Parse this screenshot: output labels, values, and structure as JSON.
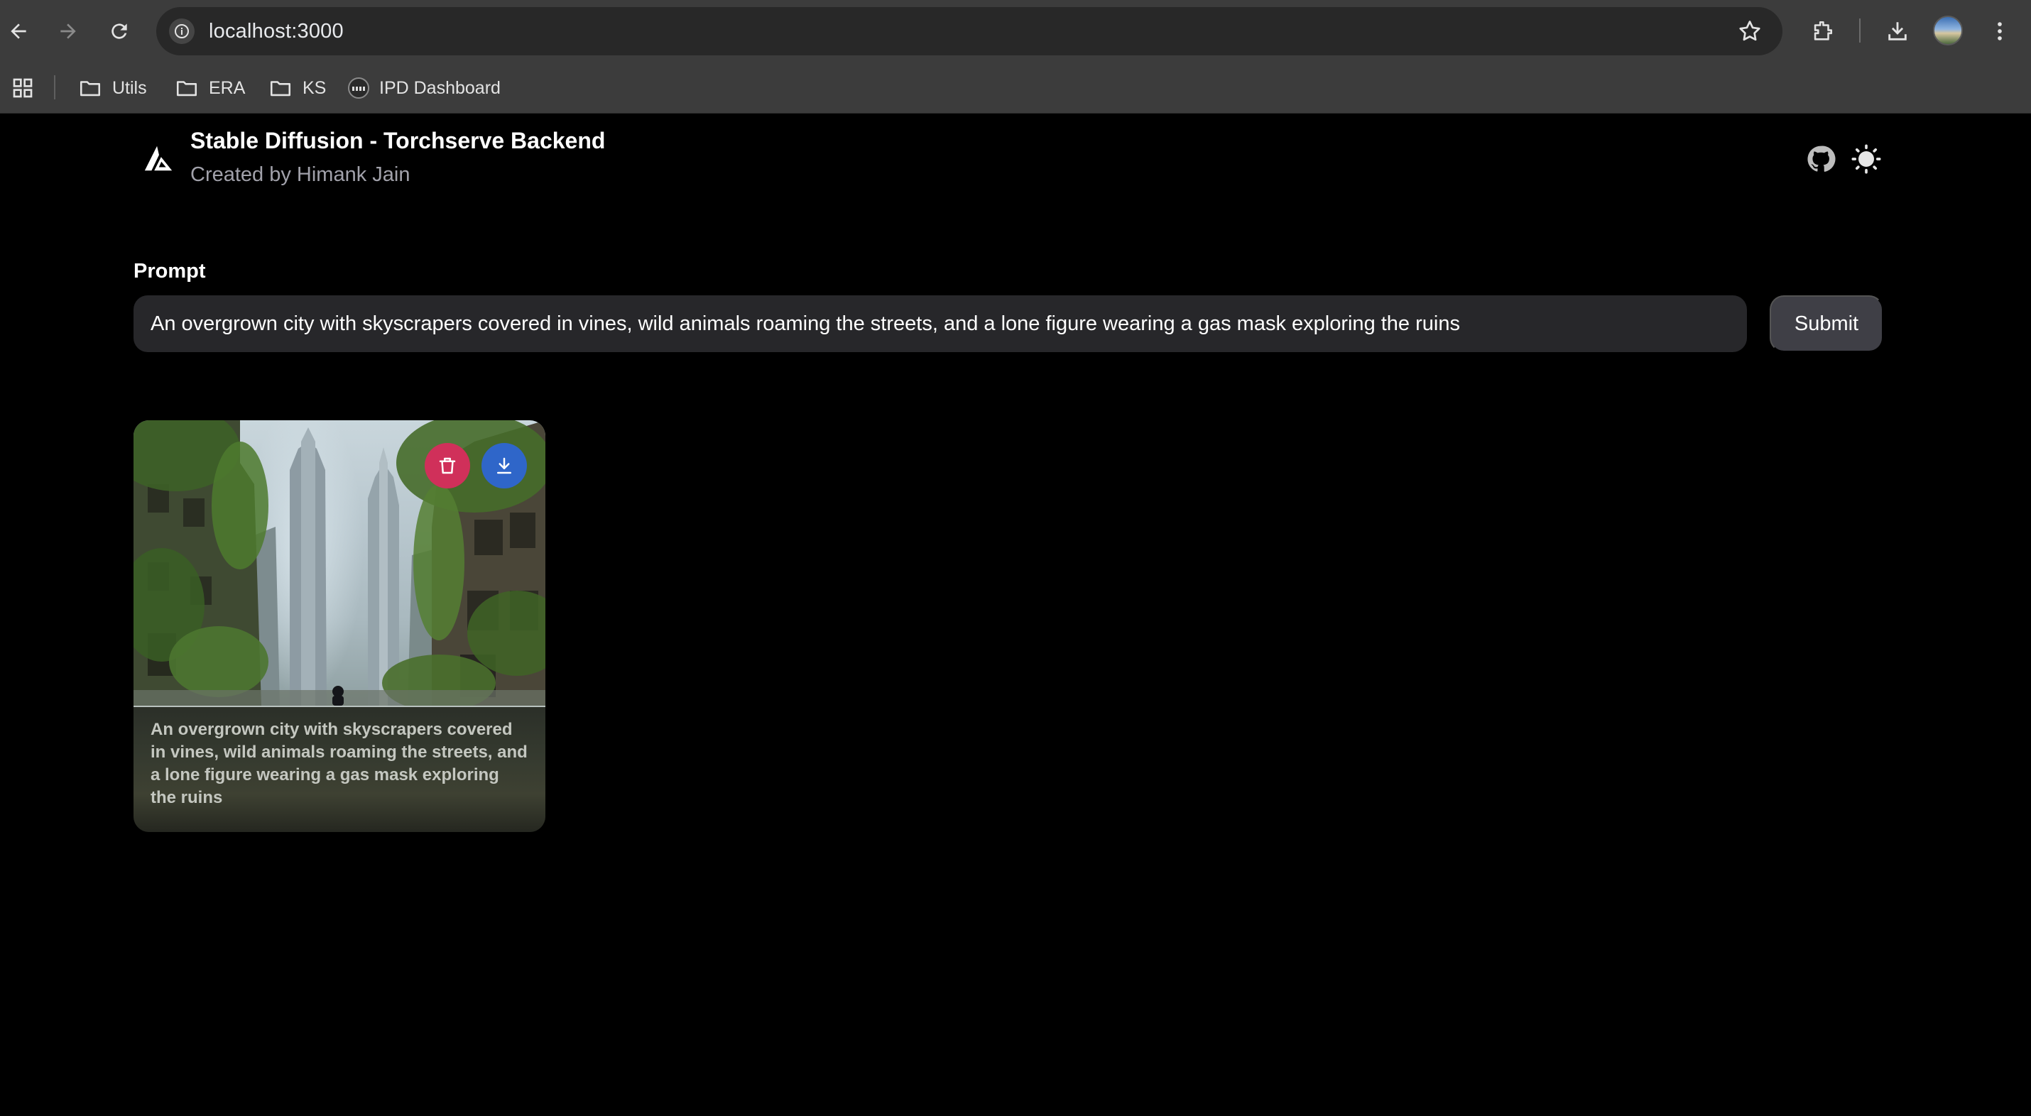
{
  "browser": {
    "url": "localhost:3000",
    "bookmarks": [
      {
        "label": "Utils",
        "icon": "folder-icon"
      },
      {
        "label": "ERA",
        "icon": "folder-icon"
      },
      {
        "label": "KS",
        "icon": "folder-icon"
      },
      {
        "label": "IPD Dashboard",
        "icon": "site-favicon"
      }
    ]
  },
  "header": {
    "title": "Stable Diffusion - Torchserve Backend",
    "subtitle": "Created by Himank Jain",
    "icons": [
      "github-icon",
      "theme-toggle-sun-icon"
    ]
  },
  "form": {
    "label": "Prompt",
    "prompt_value": "An overgrown city with skyscrapers covered in vines, wild animals roaming the streets, and a lone figure wearing a gas mask exploring the ruins",
    "submit_label": "Submit"
  },
  "gallery": {
    "items": [
      {
        "caption": "An overgrown city with skyscrapers covered in vines, wild animals roaming the streets, and a lone figure wearing a gas mask exploring the ruins",
        "delete_icon": "trash-icon",
        "download_icon": "download-icon"
      }
    ]
  },
  "colors": {
    "page_bg": "#000000",
    "input_bg": "#27272a",
    "submit_bg": "#3f3f46",
    "delete_accent": "#d0305a",
    "download_accent": "#2f66c9"
  }
}
